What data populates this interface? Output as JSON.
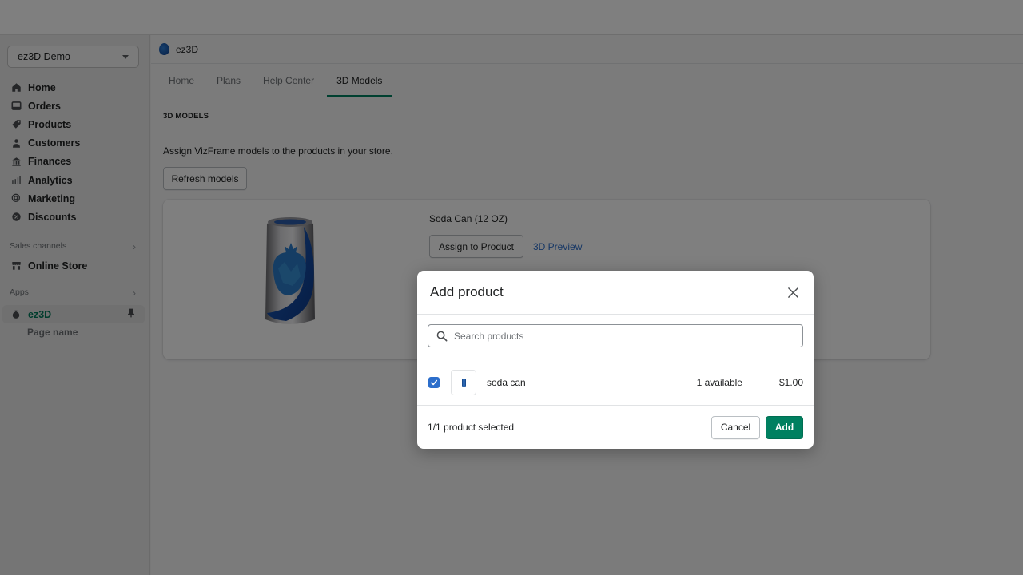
{
  "sidebar": {
    "store_selector": "ez3D Demo",
    "nav_items": [
      {
        "label": "Home",
        "icon": "home-icon"
      },
      {
        "label": "Orders",
        "icon": "orders-icon"
      },
      {
        "label": "Products",
        "icon": "tag-icon"
      },
      {
        "label": "Customers",
        "icon": "person-icon"
      },
      {
        "label": "Finances",
        "icon": "bank-icon"
      },
      {
        "label": "Analytics",
        "icon": "bar-chart-icon"
      },
      {
        "label": "Marketing",
        "icon": "target-icon"
      },
      {
        "label": "Discounts",
        "icon": "discount-icon"
      }
    ],
    "sales_channels_label": "Sales channels",
    "online_store": "Online Store",
    "apps_label": "Apps",
    "app_name": "ez3D",
    "page_name": "Page name"
  },
  "app_header": {
    "title": "ez3D"
  },
  "tabs": [
    {
      "label": "Home",
      "active": false
    },
    {
      "label": "Plans",
      "active": false
    },
    {
      "label": "Help Center",
      "active": false
    },
    {
      "label": "3D Models",
      "active": true
    }
  ],
  "page": {
    "section_title": "3D MODELS",
    "subtitle": "Assign VizFrame models to the products in your store.",
    "refresh_button": "Refresh models",
    "model": {
      "name": "Soda Can (12 OZ)",
      "assign_button": "Assign to Product",
      "preview_link": "3D Preview"
    }
  },
  "modal": {
    "title": "Add product",
    "search_placeholder": "Search products",
    "search_value": "",
    "products": [
      {
        "name": "soda can",
        "availability": "1 available",
        "price": "$1.00",
        "checked": true
      }
    ],
    "selected_count": "1/1 product selected",
    "cancel_button": "Cancel",
    "add_button": "Add"
  },
  "colors": {
    "accent_green": "#008060",
    "link_blue": "#2c6ecb",
    "checkbox_blue": "#2c6ecb"
  }
}
